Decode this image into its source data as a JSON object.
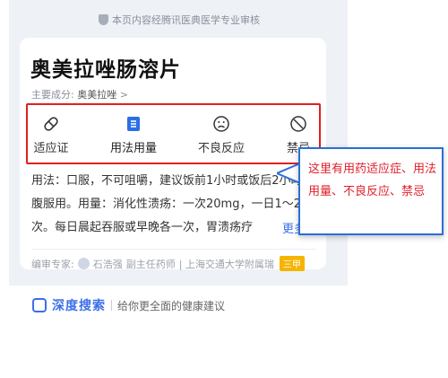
{
  "review_banner": "本页内容经腾讯医典医学专业审核",
  "drug": {
    "title": "奥美拉唑肠溶片",
    "ingredient_label": "主要成分:",
    "ingredient_value": "奥美拉唑",
    "chevron": ">"
  },
  "tabs": [
    {
      "label": "适应证",
      "icon": "pill-icon"
    },
    {
      "label": "用法用量",
      "icon": "dosage-doc-icon"
    },
    {
      "label": "不良反应",
      "icon": "sad-face-icon"
    },
    {
      "label": "禁忌",
      "icon": "forbidden-icon"
    }
  ],
  "content": {
    "text": "用法：口服，不可咀嚼，建议饭前1小时或饭后2小时空腹服用。用量：消化性溃疡：一次20mg，一日1～2次。每日晨起吞服或早晚各一次，胃溃疡疗",
    "more": "更多"
  },
  "author": {
    "label": "编审专家:",
    "name": "石浩强",
    "title": "副主任药师",
    "hospital": "| 上海交通大学附属瑞",
    "badge": "三甲"
  },
  "bottom": {
    "brand": "深度搜索",
    "slogan": "给你更全面的健康建议"
  },
  "callout": {
    "text": "这里有用药适应症、用法用量、不良反应、禁忌"
  },
  "colors": {
    "accent": "#3b6fe8",
    "highlight_border": "#e02020",
    "callout_border": "#2a6fd9",
    "callout_text": "#e0202a"
  }
}
